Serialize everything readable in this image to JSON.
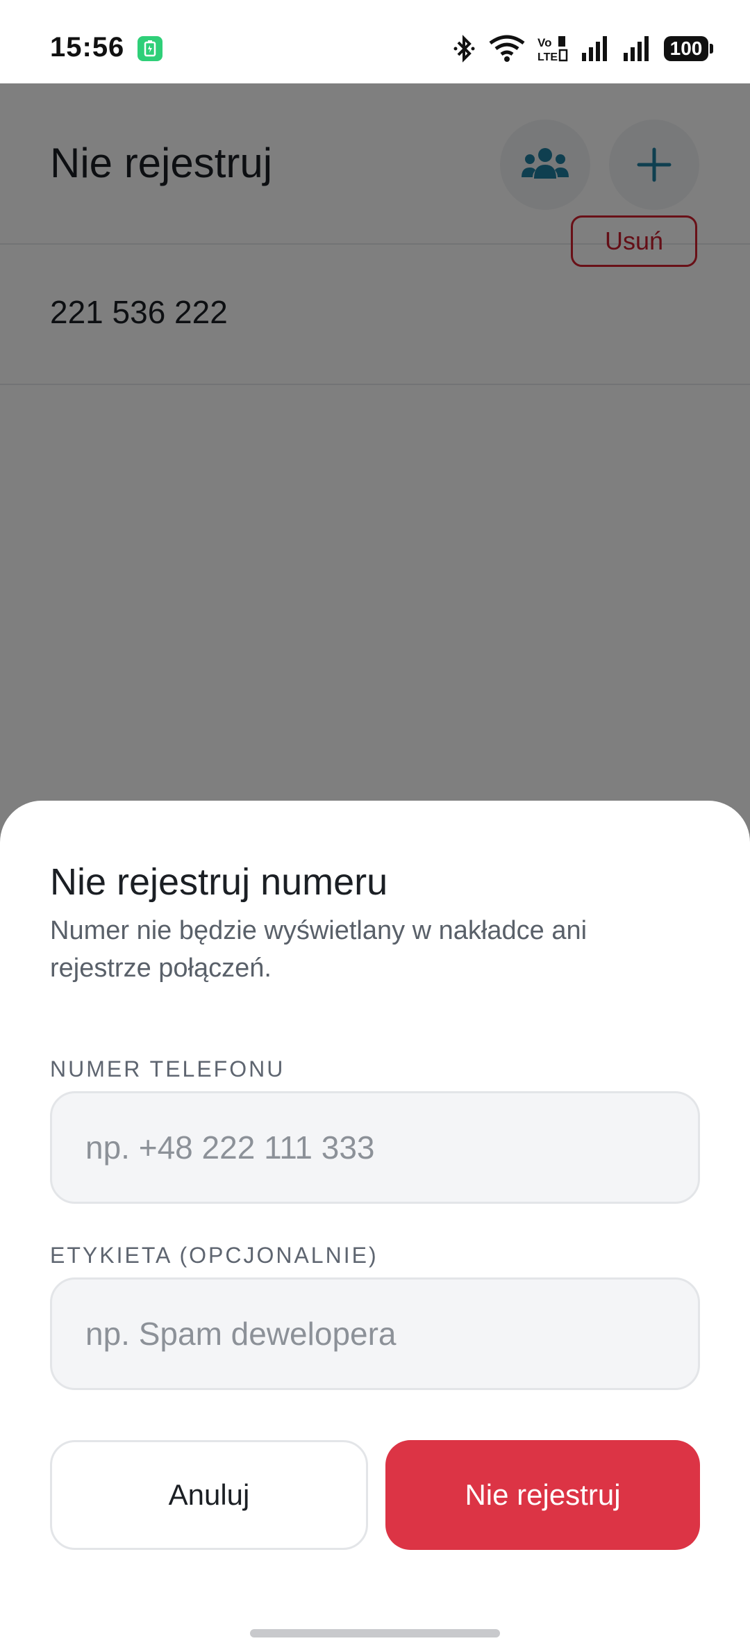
{
  "status_bar": {
    "time": "15:56",
    "battery_level": "100",
    "icons": [
      "battery-saver-icon",
      "bluetooth-icon",
      "wifi-icon",
      "volte-icon",
      "signal-icon",
      "signal-icon",
      "battery-icon"
    ]
  },
  "header": {
    "title": "Nie rejestruj",
    "group_button_icon": "group-icon",
    "add_button_icon": "plus-icon"
  },
  "list": {
    "items": [
      {
        "number": "221 536 222",
        "remove_label": "Usuń"
      }
    ]
  },
  "sheet": {
    "title": "Nie rejestruj numeru",
    "description": "Numer nie będzie wyświetlany w nakładce ani rejestrze połączeń.",
    "phone_label": "NUMER TELEFONU",
    "phone_placeholder": "np. +48 222 111 333",
    "phone_value": "",
    "tag_label": "ETYKIETA (OPCJONALNIE)",
    "tag_placeholder": "np. Spam dewelopera",
    "tag_value": "",
    "cancel_label": "Anuluj",
    "confirm_label": "Nie rejestruj"
  },
  "colors": {
    "accent": "#1e7fa0",
    "danger": "#dc3445",
    "danger_outline": "#d3202f"
  }
}
